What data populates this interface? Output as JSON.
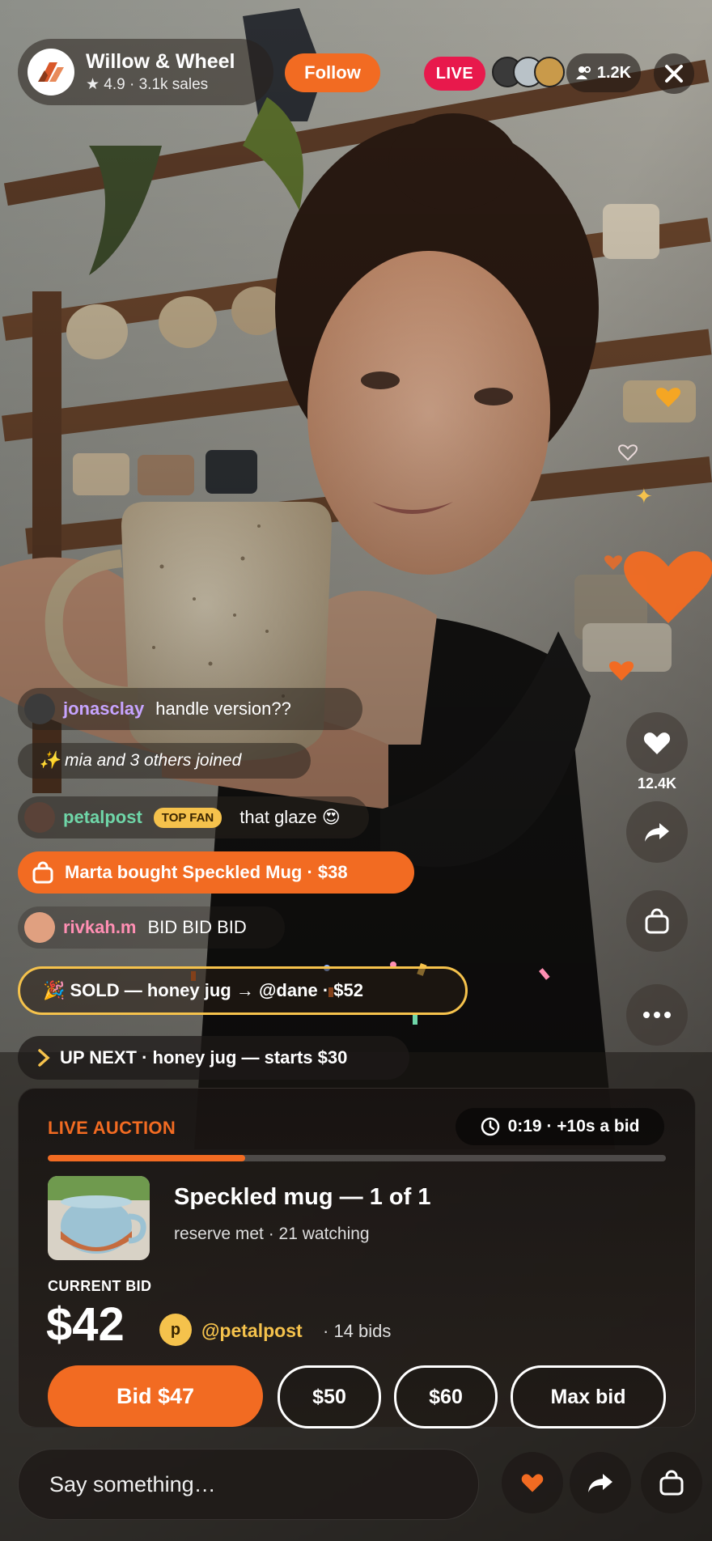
{
  "seller": {
    "name": "Willow & Wheel",
    "meta": "★ 4.9 · 3.1k sales",
    "follow_label": "Follow"
  },
  "stream": {
    "live_label": "LIVE",
    "viewer_count": "1.2K",
    "like_count": "12.4K"
  },
  "chat": [
    {
      "user": "jonasclay",
      "user_color": "#c7a4ff",
      "text": "handle version??"
    },
    {
      "system": "✨ mia and 3 others joined"
    },
    {
      "user": "petalpost",
      "user_color": "#6fd6a8",
      "badge": "TOP FAN",
      "text": "that glaze 😍"
    },
    {
      "purchase": "Marta bought Speckled Mug · $38"
    },
    {
      "user": "rivkah.m",
      "user_color": "#ff8fb3",
      "text": "BID BID BID"
    },
    {
      "sold": "🎉 SOLD — honey jug → @dane · $52"
    },
    {
      "up_next": "UP NEXT · honey jug — starts $30"
    }
  ],
  "auction": {
    "label": "LIVE AUCTION",
    "timer": "0:19 · +10s a bid",
    "progress": 0.32,
    "item_title": "Speckled mug — 1 of 1",
    "item_sub": "reserve met · 21 watching",
    "current_bid_label": "CURRENT BID",
    "current_bid": "$42",
    "bidder_initial": "p",
    "bidder": "@petalpost",
    "bids": "· 14 bids",
    "bid_main": "Bid $47",
    "bid_options": [
      "$50",
      "$60",
      "Max bid"
    ]
  },
  "composer": {
    "placeholder": "Say something…"
  },
  "colors": {
    "accent": "#f26b22",
    "live": "#e8194c",
    "gold": "#f5c24c"
  }
}
